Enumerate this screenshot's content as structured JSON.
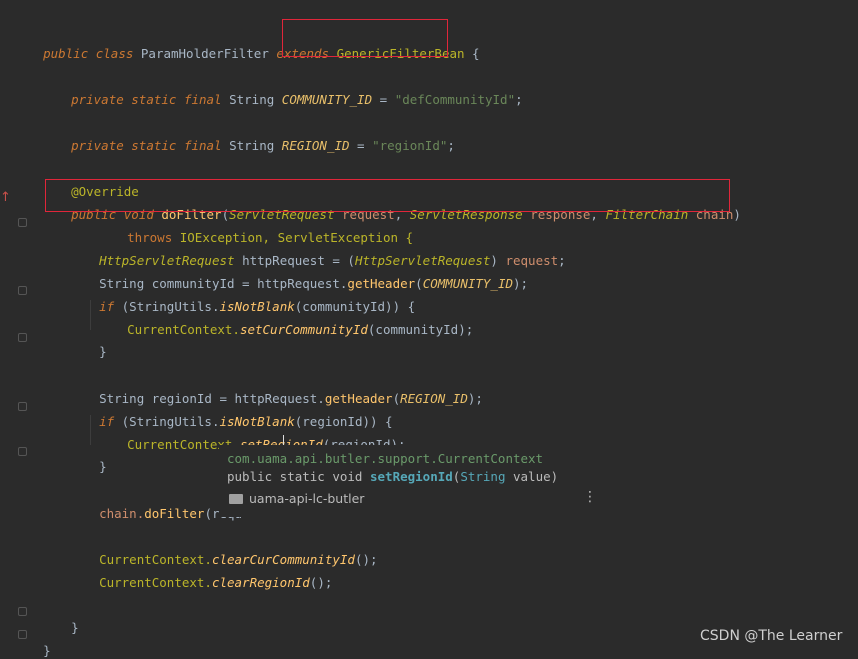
{
  "code": {
    "l1": {
      "kw1": "public class ",
      "name": "ParamHolderFilter ",
      "kw2": "extends ",
      "parent": "GenericFilterBean",
      "brace": " {"
    },
    "l2": {
      "kw": "private static final ",
      "type": "String ",
      "field": "COMMUNITY_ID",
      "eq": " = ",
      "val": "\"defCommunityId\"",
      "end": ";"
    },
    "l3": {
      "kw": "private static final ",
      "type": "String ",
      "field": "REGION_ID",
      "eq": " = ",
      "val": "\"regionId\"",
      "end": ";"
    },
    "l4": {
      "ann": "@Override"
    },
    "l5": {
      "kw": "public void ",
      "name": "doFilter",
      "p1": "(",
      "t1": "ServletRequest ",
      "a1": "request",
      "c1": ", ",
      "t2": "ServletResponse ",
      "a2": "response",
      "c2": ", ",
      "t3": "FilterChain ",
      "a3": "chain",
      "p2": ")"
    },
    "l6": {
      "kw": "throws ",
      "ex": "IOException, ServletException {"
    },
    "l7": {
      "t": "HttpServletRequest ",
      "v": "httpRequest = (",
      "cast": "HttpServletRequest",
      "r": ") ",
      "a": "request",
      "e": ";"
    },
    "l8": {
      "t": "String communityId = httpRequest.",
      "m": "getHeader",
      "p": "(",
      "f": "COMMUNITY_ID",
      "e": ");"
    },
    "l9": {
      "kw": "if ",
      "p": "(StringUtils.",
      "m": "isNotBlank",
      "r": "(communityId)) {"
    },
    "l10": {
      "c": "CurrentContext.",
      "m": "setCurCommunityId",
      "r": "(communityId);"
    },
    "l11": {
      "t": "}"
    },
    "l12": {
      "t": "String regionId = httpRequest.",
      "m": "getHeader",
      "p": "(",
      "f": "REGION_ID",
      "e": ");"
    },
    "l13": {
      "kw": "if ",
      "p": "(StringUtils.",
      "m": "isNotBlank",
      "r": "(regionId)) {"
    },
    "l14": {
      "c": "CurrentContext.",
      "m": "setRegionId",
      "r": "(regionId);"
    },
    "l15": {
      "t": "}"
    },
    "l16": {
      "c": "chain.",
      "m": "doFilter",
      "r": "(requ"
    },
    "l17": {
      "c": "CurrentContext.",
      "m": "clearCurCommunityId",
      "r": "();"
    },
    "l18": {
      "c": "CurrentContext.",
      "m": "clearRegionId",
      "r": "();"
    },
    "l19": {
      "t": "}"
    },
    "l20": {
      "t": "}"
    }
  },
  "popup": {
    "package": "com.uama.api.butler.support.CurrentContext",
    "sig_pre": "public static void ",
    "sig_method": "setRegionId",
    "sig_open": "(",
    "sig_type": "String",
    "sig_rest": " value)",
    "module": "uama-api-lc-butler",
    "more": "⋮"
  },
  "watermark": "CSDN @The Learner",
  "gutter_arrow": "↑"
}
